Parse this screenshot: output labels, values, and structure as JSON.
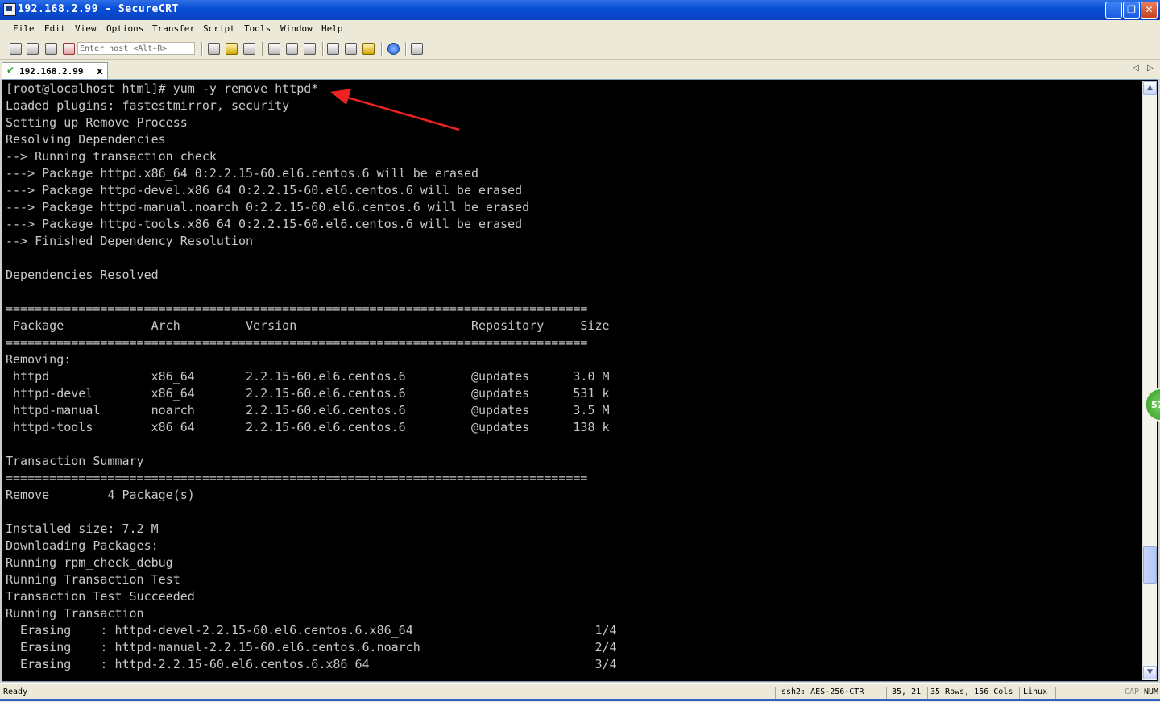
{
  "window": {
    "title": "192.168.2.99 - SecureCRT",
    "minimize": "_",
    "maximize": "❐",
    "close": "✕"
  },
  "menu": [
    "File",
    "Edit",
    "View",
    "Options",
    "Transfer",
    "Script",
    "Tools",
    "Window",
    "Help"
  ],
  "toolbar": {
    "host_placeholder": "Enter host <Alt+R>"
  },
  "tab": {
    "label": "192.168.2.99",
    "close": "x",
    "nav_left": "◁",
    "nav_right": "▷"
  },
  "terminal": {
    "lines": [
      "[root@localhost html]# yum -y remove httpd*",
      "Loaded plugins: fastestmirror, security",
      "Setting up Remove Process",
      "Resolving Dependencies",
      "--> Running transaction check",
      "---> Package httpd.x86_64 0:2.2.15-60.el6.centos.6 will be erased",
      "---> Package httpd-devel.x86_64 0:2.2.15-60.el6.centos.6 will be erased",
      "---> Package httpd-manual.noarch 0:2.2.15-60.el6.centos.6 will be erased",
      "---> Package httpd-tools.x86_64 0:2.2.15-60.el6.centos.6 will be erased",
      "--> Finished Dependency Resolution",
      "",
      "Dependencies Resolved",
      "",
      "================================================================================",
      " Package            Arch         Version                        Repository     Size",
      "================================================================================",
      "Removing:",
      " httpd              x86_64       2.2.15-60.el6.centos.6         @updates      3.0 M",
      " httpd-devel        x86_64       2.2.15-60.el6.centos.6         @updates      531 k",
      " httpd-manual       noarch       2.2.15-60.el6.centos.6         @updates      3.5 M",
      " httpd-tools        x86_64       2.2.15-60.el6.centos.6         @updates      138 k",
      "",
      "Transaction Summary",
      "================================================================================",
      "Remove        4 Package(s)",
      "",
      "Installed size: 7.2 M",
      "Downloading Packages:",
      "Running rpm_check_debug",
      "Running Transaction Test",
      "Transaction Test Succeeded",
      "Running Transaction",
      "  Erasing    : httpd-devel-2.2.15-60.el6.centos.6.x86_64                         1/4",
      "  Erasing    : httpd-manual-2.2.15-60.el6.centos.6.noarch                        2/4",
      "  Erasing    : httpd-2.2.15-60.el6.centos.6.x86_64                               3/4"
    ]
  },
  "scrollbar": {
    "up": "▲",
    "down": "▼"
  },
  "badge": "57",
  "status": {
    "ready": "Ready",
    "cipher": "ssh2: AES-256-CTR",
    "cursor": "35,  21",
    "size": "35 Rows, 156 Cols",
    "os": "Linux",
    "cap": "CAP",
    "num": "NUM"
  }
}
